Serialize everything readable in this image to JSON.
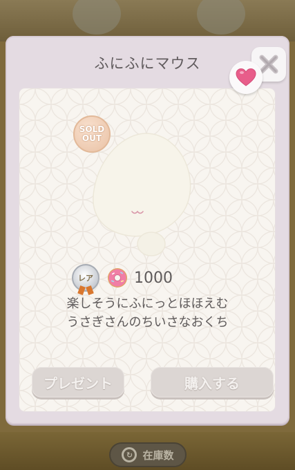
{
  "dialog": {
    "title": "ふにふにマウス",
    "close_icon": "close-x-icon",
    "favorite_icon": "heart-icon",
    "sold_out_line1": "SOLD",
    "sold_out_line2": "OUT",
    "rarity_label": "レア",
    "currency_icon": "donut-icon",
    "price": "1000",
    "description_line1": "楽しそうにふにっとほほえむ",
    "description_line2": "うさぎさんのちいさなおくち",
    "present_button": "プレゼント",
    "buy_button": "購入する"
  },
  "footer": {
    "stock_label": "在庫数"
  },
  "colors": {
    "dialog_bg": "#e4dbe2",
    "panel_bg": "#f8f5f0",
    "heart": "#e85d8a",
    "text": "#5e5a5a"
  }
}
